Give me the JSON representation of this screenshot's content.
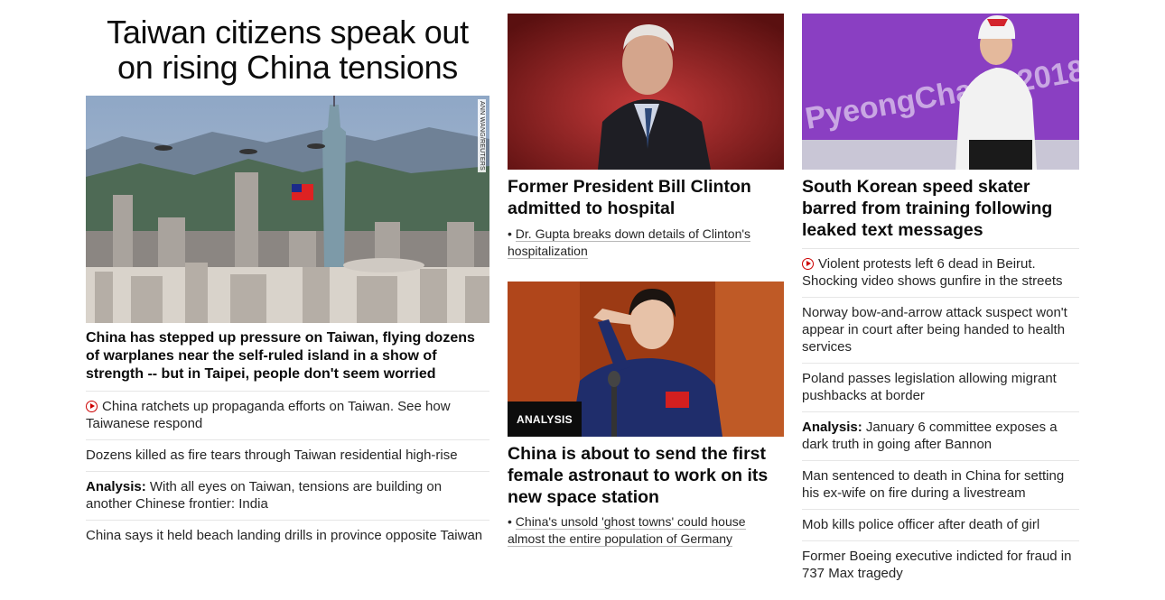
{
  "col1": {
    "title": "Taiwan citizens speak out on rising China tensions",
    "photo_credit": "ANN WANG/REUTERS",
    "lead_text": "China has stepped up pressure on Taiwan, flying dozens of warplanes near the self-ruled island in a show of strength -- but in Taipei, people don't seem worried",
    "items": [
      {
        "has_video": true,
        "prefix": "",
        "text": "China ratchets up propaganda efforts on Taiwan. See how Taiwanese respond"
      },
      {
        "has_video": false,
        "prefix": "",
        "text": "Dozens killed as fire tears through Taiwan residential high-rise"
      },
      {
        "has_video": false,
        "prefix": "Analysis:",
        "text": " With all eyes on Taiwan, tensions are building on another Chinese frontier: India"
      },
      {
        "has_video": false,
        "prefix": "",
        "text": "China says it held beach landing drills in province opposite Taiwan"
      }
    ]
  },
  "col2": {
    "story1": {
      "headline": "Former President Bill Clinton admitted to hospital",
      "sub_bullet": "• ",
      "sub": "Dr. Gupta breaks down details of Clinton's hospitalization"
    },
    "story2": {
      "badge": "ANALYSIS",
      "headline": "China is about to send the first female astronaut to work on its new space station",
      "sub_bullet": "• ",
      "sub": "China's unsold 'ghost towns' could house almost the entire population of Germany"
    }
  },
  "col3": {
    "image_text": "PyeongChang 2018",
    "headline": "South Korean speed skater barred from training following leaked text messages",
    "items": [
      {
        "has_video": true,
        "prefix": "",
        "text": "Violent protests left 6 dead in Beirut. Shocking video shows gunfire in the streets"
      },
      {
        "has_video": false,
        "prefix": "",
        "text": "Norway bow-and-arrow attack suspect won't appear in court after being handed to health services"
      },
      {
        "has_video": false,
        "prefix": "",
        "text": "Poland passes legislation allowing migrant pushbacks at border"
      },
      {
        "has_video": false,
        "prefix": "Analysis:",
        "text": " January 6 committee exposes a dark truth in going after Bannon"
      },
      {
        "has_video": false,
        "prefix": "",
        "text": "Man sentenced to death in China for setting his ex-wife on fire during a livestream"
      },
      {
        "has_video": false,
        "prefix": "",
        "text": "Mob kills police officer after death of girl"
      },
      {
        "has_video": false,
        "prefix": "",
        "text": "Former Boeing executive indicted for fraud in 737 Max tragedy"
      }
    ]
  },
  "colors": {
    "accent": "#cc0000",
    "text": "#262626",
    "divider": "#e6e6e6"
  }
}
